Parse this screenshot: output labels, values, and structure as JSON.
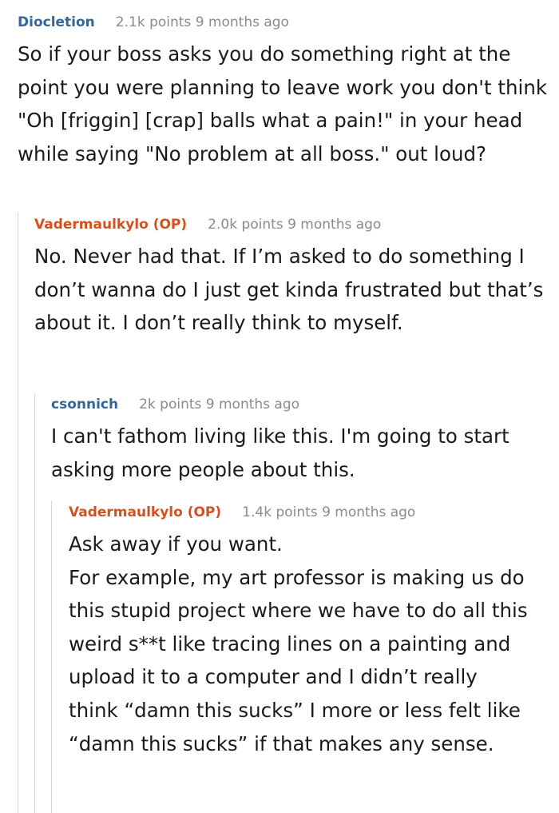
{
  "comments": [
    {
      "author": "Diocletion",
      "points": "2.1k points 9 months ago",
      "paragraphs": [
        "So if your boss asks you do something right at the point you were planning to leave work you don't think \"Oh [friggin] [crap] balls what a pain!\" in your head while saying \"No problem at all boss.\" out loud?"
      ]
    },
    {
      "author": "Vadermaulkylo (OP)",
      "points": "2.0k points 9 months ago",
      "paragraphs": [
        "No. Never had that. If I’m asked to do something I don’t wanna do I just get kinda frustrated but that’s about it. I don’t really think to myself."
      ]
    },
    {
      "author": "csonnich",
      "points": "2k points 9 months ago",
      "paragraphs": [
        "I can't fathom living like this. I'm going to start asking more people about this."
      ]
    },
    {
      "author": "Vadermaulkylo (OP)",
      "points": "1.4k points 9 months ago",
      "paragraphs": [
        "Ask away if you want.",
        "For example, my art professor is making us do this stupid project where we have to do all this weird s**t like tracing lines on a painting and upload it to a computer and I didn’t really think “damn this sucks” I more or less felt like “damn this sucks” if that makes any sense."
      ]
    }
  ],
  "colors": {
    "author_regular": "#336699",
    "author_op": "#d2521f",
    "meta_gray": "#8a8a8a",
    "thread_line": "#d5d5d5"
  }
}
